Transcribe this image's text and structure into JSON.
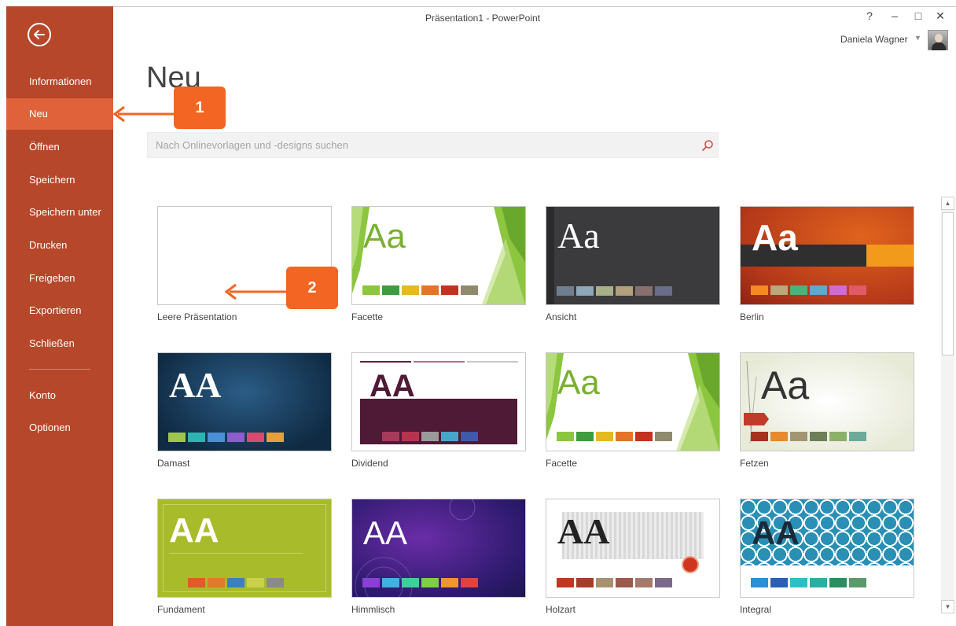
{
  "window": {
    "title": "Präsentation1 - PowerPoint",
    "help_label": "?",
    "minimize_label": "–",
    "maximize_label": "□",
    "close_label": "✕",
    "user_name": "Daniela Wagner"
  },
  "sidebar": {
    "accent": "#b7472a",
    "active_color": "#e0623a",
    "items": [
      {
        "label": "Informationen"
      },
      {
        "label": "Neu"
      },
      {
        "label": "Öffnen"
      },
      {
        "label": "Speichern"
      },
      {
        "label": "Speichern unter"
      },
      {
        "label": "Drucken"
      },
      {
        "label": "Freigeben"
      },
      {
        "label": "Exportieren"
      },
      {
        "label": "Schließen"
      },
      {
        "label": "Konto"
      },
      {
        "label": "Optionen"
      }
    ]
  },
  "main": {
    "title": "Neu",
    "search_placeholder": "Nach Onlinevorlagen und -designs suchen"
  },
  "templates": [
    {
      "name": "Leere Präsentation"
    },
    {
      "name": "Facette"
    },
    {
      "name": "Ansicht"
    },
    {
      "name": "Berlin"
    },
    {
      "name": "Damast"
    },
    {
      "name": "Dividend"
    },
    {
      "name": "Facette"
    },
    {
      "name": "Fetzen"
    },
    {
      "name": "Fundament"
    },
    {
      "name": "Himmlisch"
    },
    {
      "name": "Holzart"
    },
    {
      "name": "Integral"
    }
  ],
  "thumb_text": {
    "facette": "Aa",
    "ansicht": "Aa",
    "berlin": "Aa",
    "damast": "AA",
    "dividend": "AA",
    "facette2": "Aa",
    "fetzen": "Aa",
    "fundament": "AA",
    "himmlisch": "AA",
    "holzart": "AA",
    "integral": "AA"
  },
  "callouts": {
    "one": "1",
    "two": "2",
    "color": "#f26522"
  }
}
